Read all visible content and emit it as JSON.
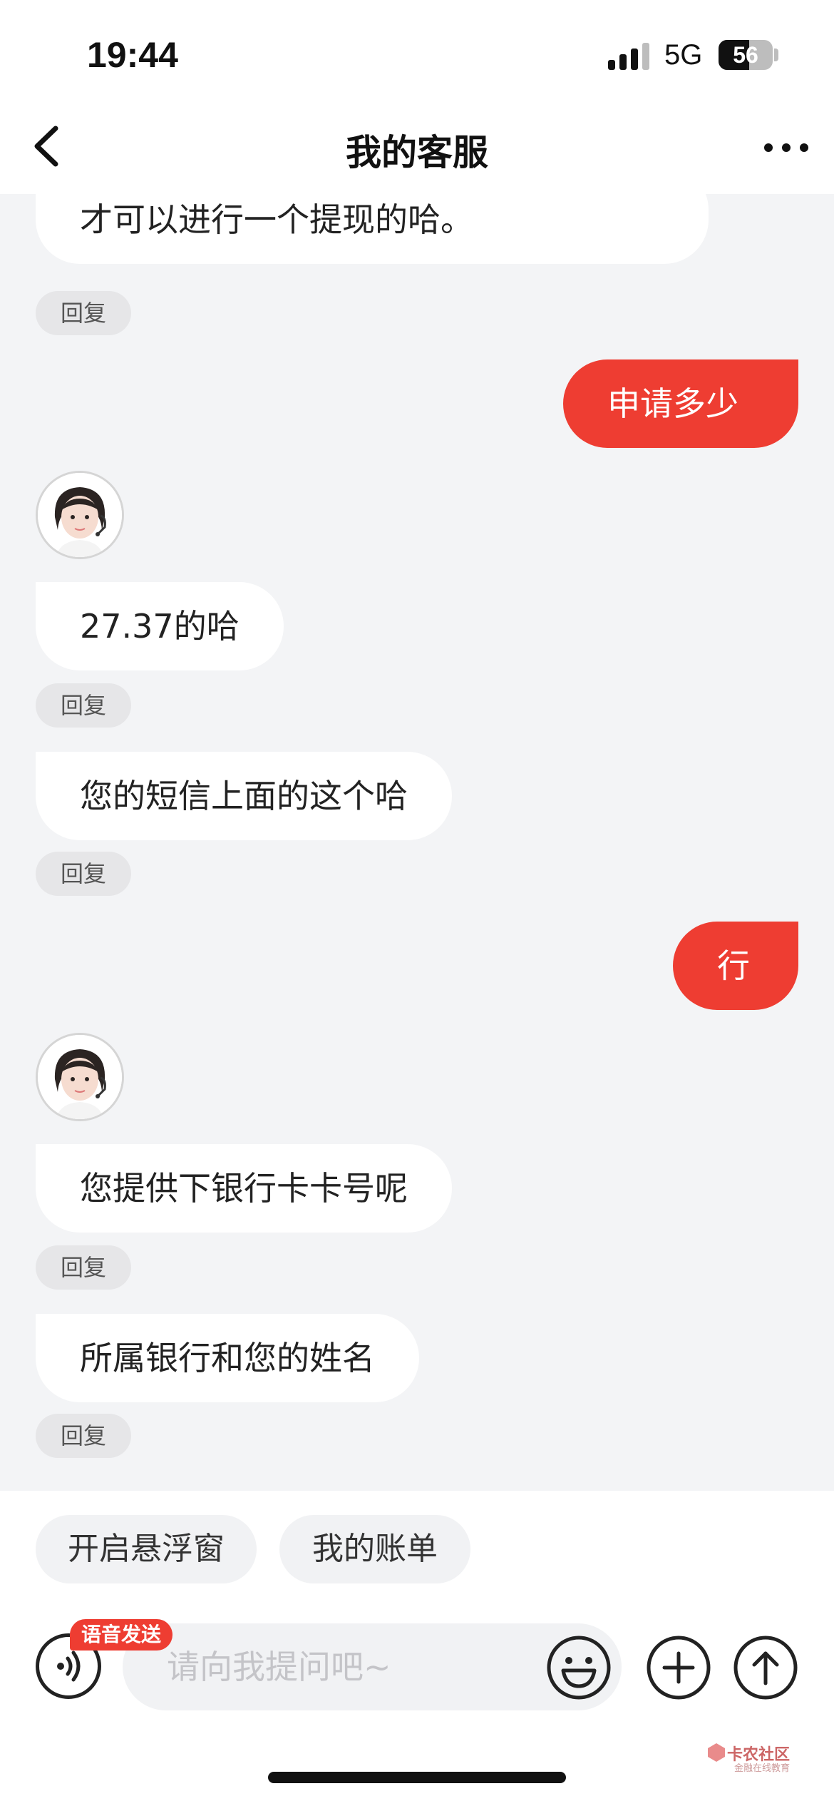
{
  "status": {
    "time": "19:44",
    "network": "5G",
    "battery": "56",
    "battery_level": 0.56
  },
  "header": {
    "title": "我的客服"
  },
  "chat": {
    "top_partial_text": "才可以进行一个提现的哈。",
    "reply_label": "回复",
    "messages": [
      {
        "side": "right",
        "text": "申请多少"
      },
      {
        "side": "left",
        "text": "27.37的哈"
      },
      {
        "side": "left",
        "text": "您的短信上面的这个哈"
      },
      {
        "side": "right",
        "text": "行"
      },
      {
        "side": "left",
        "text": "您提供下银行卡卡号呢"
      },
      {
        "side": "left",
        "text": "所属银行和您的姓名"
      }
    ]
  },
  "quick_actions": [
    "开启悬浮窗",
    "我的账单"
  ],
  "input": {
    "placeholder": "请向我提问吧~",
    "voice_tag": "语音发送"
  },
  "icons": [
    "back-icon",
    "more-icon",
    "voice-icon",
    "emoji-icon",
    "plus-icon",
    "send-icon",
    "signal-icon"
  ],
  "watermark": {
    "title": "卡农社区",
    "subtitle": "金融在线教育"
  },
  "colors": {
    "accent": "#ee3d32",
    "background": "#f3f4f6",
    "bubble_left": "#ffffff"
  }
}
